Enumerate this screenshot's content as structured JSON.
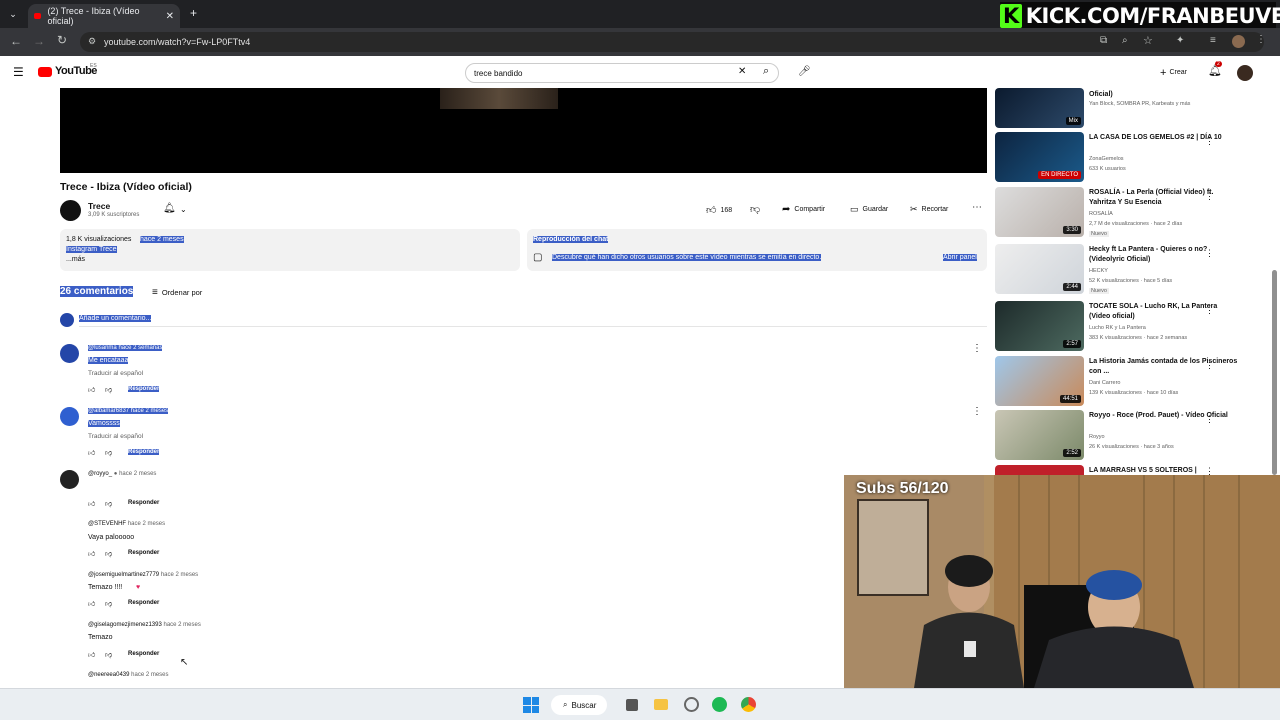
{
  "browser": {
    "tab_title": "(2) Trece - Ibiza (Vídeo oficial)",
    "url": "youtube.com/watch?v=Fw-LP0FTtv4"
  },
  "overlay": {
    "kick_text": "KICK.COM/FRANBEUVE",
    "subs_text": "Subs 56/120"
  },
  "youtube": {
    "logo": "YouTube",
    "region": "ES",
    "search_value": "trece bandido",
    "create_label": "Crear",
    "notif_count": "2"
  },
  "video": {
    "title": "Trece - Ibiza (Vídeo oficial)",
    "channel": "Trece",
    "subscribers": "3,09 K suscriptores",
    "likes": "168",
    "share": "Compartir",
    "save": "Guardar",
    "clip": "Recortar",
    "views": "1,8 K visualizaciones",
    "age": "hace 2 meses",
    "desc_line": "Instagram Trece",
    "more": "...más",
    "chat_title": "Reproducción del chat",
    "chat_desc": "Descubre qué han dicho otros usuarios sobre este vídeo mientras se emitía en directo.",
    "chat_open": "Abrir panel"
  },
  "comments": {
    "count": "26 comentarios",
    "sort": "Ordenar por",
    "add": "Añade un comentario...",
    "translate": "Traducir al español",
    "reply": "Responder",
    "items": [
      {
        "author": "@lusanma",
        "age": "hace 2 semanas",
        "text": "Me encataaa"
      },
      {
        "author": "@albamar6837",
        "age": "hace 2 meses",
        "text": "Vamossss"
      },
      {
        "author": "@royyo_",
        "age": "hace 2 meses",
        "text": ""
      },
      {
        "author": "@STEVENHF",
        "age": "hace 2 meses",
        "text": "Vaya palooooo"
      },
      {
        "author": "@josemiguelmartinez7779",
        "age": "hace 2 meses",
        "text": "Temazo !!!!"
      },
      {
        "author": "@giselagomezjimenez1393",
        "age": "hace 2 meses",
        "text": "Temazo"
      },
      {
        "author": "@neereea0439",
        "age": "hace 2 meses",
        "text": ""
      }
    ]
  },
  "sidebar": [
    {
      "title": "Oficial)",
      "channel": "Yan Block, SOMBRA PR, Karbeats y más",
      "meta": "",
      "badge": "Mix"
    },
    {
      "title": "LA CASA DE LOS GEMELOS #2 | DÍA 10",
      "channel": "ZonaGemelos",
      "meta": "633 K usuarios",
      "badge": "EN DIRECTO"
    },
    {
      "title": "ROSALÍA - La Perla (Official Video) ft. Yahritza Y Su Esencia",
      "channel": "ROSALÍA",
      "meta": "2,7 M de visualizaciones · hace 2 días",
      "extra": "Nuevo",
      "badge": "3:30"
    },
    {
      "title": "Hecky ft La Pantera - Quieres o no? (Videolyric Oficial)",
      "channel": "HECKY",
      "meta": "52 K visualizaciones · hace 5 días",
      "extra": "Nuevo",
      "badge": "2:44"
    },
    {
      "title": "TOCATE SOLA - Lucho RK, La Pantera (Video oficial)",
      "channel": "Lucho RK y La Pantera",
      "meta": "383 K visualizaciones · hace 2 semanas",
      "badge": "2:57"
    },
    {
      "title": "La Historia Jamás contada de los Piscineros con ...",
      "channel": "Dani Carrero",
      "meta": "139 K visualizaciones · hace 10 días",
      "badge": "44:51"
    },
    {
      "title": "Royyo - Roce (Prod. Pauet) - Vídeo Oficial",
      "channel": "Royyo",
      "meta": "26 K visualizaciones · hace 3 años",
      "badge": "2:52"
    },
    {
      "title": "LA MARRASH VS 5 SOLTEROS |",
      "channel": "",
      "meta": "",
      "badge": ""
    }
  ],
  "taskbar": {
    "search_label": "Buscar"
  }
}
